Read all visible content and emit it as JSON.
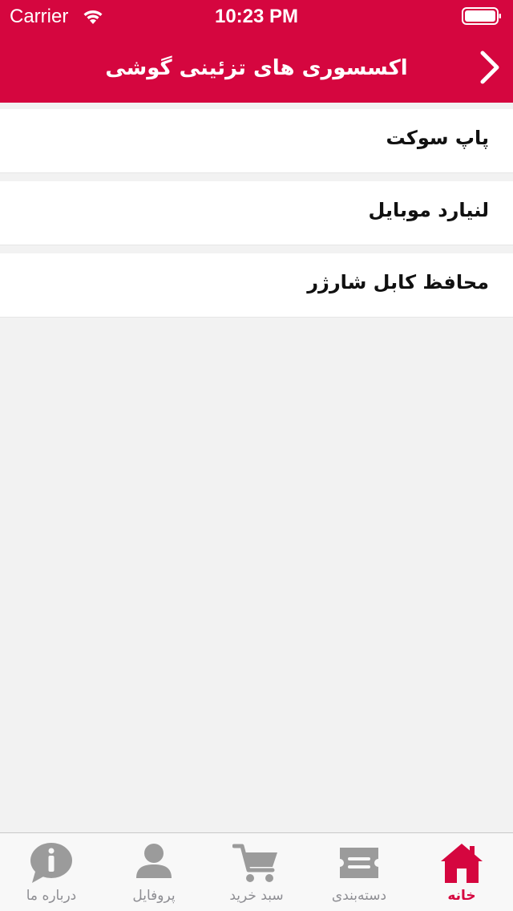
{
  "status_bar": {
    "carrier": "Carrier",
    "time": "10:23 PM"
  },
  "nav": {
    "title": "اکسسوری های تزئینی گوشی",
    "back_icon": "chevron-right-icon"
  },
  "categories": [
    {
      "label": "پاپ سوکت"
    },
    {
      "label": "لنیارد موبایل"
    },
    {
      "label": "محافظ کابل شارژر"
    }
  ],
  "tabs": [
    {
      "label": "درباره ما",
      "icon": "info-bubble-icon",
      "active": false
    },
    {
      "label": "پروفایل",
      "icon": "person-icon",
      "active": false
    },
    {
      "label": "سبد خرید",
      "icon": "cart-icon",
      "active": false
    },
    {
      "label": "دسته‌بندی",
      "icon": "category-ticket-icon",
      "active": false
    },
    {
      "label": "خانه",
      "icon": "home-icon",
      "active": true
    }
  ],
  "colors": {
    "brand": "#d5063f",
    "background": "#f2f2f2",
    "tab_inactive": "#9b9b9b"
  }
}
